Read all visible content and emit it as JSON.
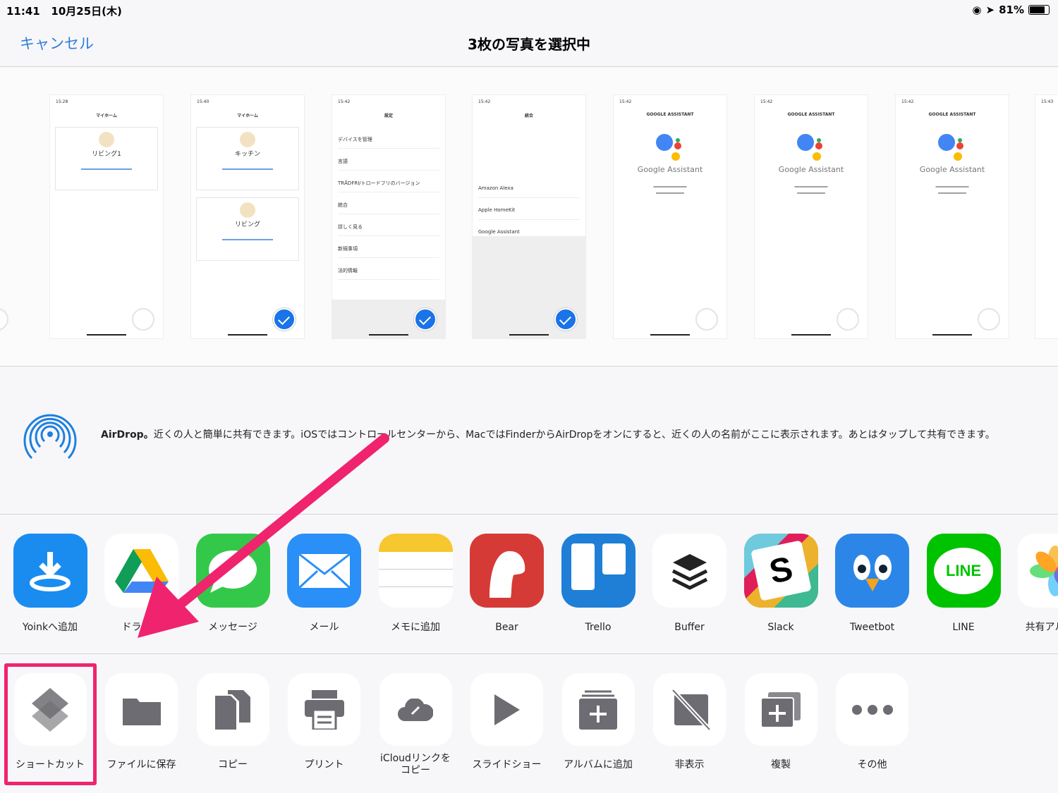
{
  "status_bar": {
    "time": "11:41",
    "date": "10月25日(木)",
    "battery": "81%",
    "battery_level": 0.81
  },
  "nav": {
    "cancel": "キャンセル",
    "title": "3枚の写真を選択中"
  },
  "photos": [
    {
      "time": "15:28",
      "header": "マイホーム",
      "cards": [
        "リビング1"
      ],
      "selected": false
    },
    {
      "time": "15:40",
      "header": "マイホーム",
      "cards": [
        "キッチン",
        "リビング"
      ],
      "selected": true
    },
    {
      "time": "15:42",
      "header": "設定",
      "rows": [
        "デバイスを管理",
        "言語",
        "TRÅDFRI/トロードフリのバージョン",
        "統合",
        "詳しく見る",
        "新規事項",
        "法的情報"
      ],
      "selected": true
    },
    {
      "time": "15:42",
      "header": "統合",
      "rows": [
        "Amazon Alexa",
        "Apple HomeKit",
        "Google Assistant"
      ],
      "selected": true
    },
    {
      "time": "15:42",
      "header": "GOOGLE ASSISTANT",
      "brand": "Google Assistant",
      "selected": false
    },
    {
      "time": "15:42",
      "header": "GOOGLE ASSISTANT",
      "brand": "Google Assistant",
      "selected": false
    },
    {
      "time": "15:42",
      "header": "GOOGLE ASSISTANT",
      "brand": "Google Assistant",
      "selected": false
    },
    {
      "time": "15:43",
      "selected": false
    }
  ],
  "airdrop": {
    "title": "AirDrop。",
    "text": "近くの人と簡単に共有できます。iOSではコントロールセンターから、MacではFinderからAirDropをオンにすると、近くの人の名前がここに表示されます。あとはタップして共有できます。"
  },
  "apps": [
    {
      "label": "Yoinkへ追加",
      "icon": "yoink-icon",
      "color": "#1a8cf0"
    },
    {
      "label": "ドライブ",
      "icon": "google-drive-icon",
      "color": "#ffffff"
    },
    {
      "label": "メッセージ",
      "icon": "messages-icon",
      "color": "#34c84a"
    },
    {
      "label": "メール",
      "icon": "mail-icon",
      "color": "#2a8ff7"
    },
    {
      "label": "メモに追加",
      "icon": "notes-icon",
      "color": "#ffffff"
    },
    {
      "label": "Bear",
      "icon": "bear-icon",
      "color": "#d63a36"
    },
    {
      "label": "Trello",
      "icon": "trello-icon",
      "color": "#1f7fd6"
    },
    {
      "label": "Buffer",
      "icon": "buffer-icon",
      "color": "#ffffff"
    },
    {
      "label": "Slack",
      "icon": "slack-icon",
      "color": "#ecb22e"
    },
    {
      "label": "Tweetbot",
      "icon": "tweetbot-icon",
      "color": "#2c86e8"
    },
    {
      "label": "LINE",
      "icon": "line-icon",
      "color": "#00c300"
    },
    {
      "label": "共有アルバム",
      "icon": "photos-icon",
      "color": "#ffffff"
    }
  ],
  "actions": [
    {
      "label": "ショートカット",
      "icon": "shortcuts-icon"
    },
    {
      "label": "ファイルに保存",
      "icon": "folder-icon"
    },
    {
      "label": "コピー",
      "icon": "copy-icon"
    },
    {
      "label": "プリント",
      "icon": "print-icon"
    },
    {
      "label": "iCloudリンクをコピー",
      "icon": "icloud-link-icon"
    },
    {
      "label": "スライドショー",
      "icon": "play-icon"
    },
    {
      "label": "アルバムに追加",
      "icon": "add-album-icon"
    },
    {
      "label": "非表示",
      "icon": "hide-icon"
    },
    {
      "label": "複製",
      "icon": "duplicate-icon"
    },
    {
      "label": "その他",
      "icon": "more-icon"
    }
  ],
  "colors": {
    "accent": "#2f7fd8",
    "highlight": "#f0236e",
    "icon_gray": "#6d6c72",
    "selected": "#1a73e8"
  }
}
